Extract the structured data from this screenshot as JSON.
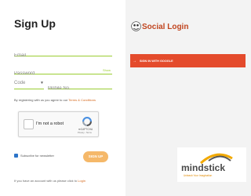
{
  "signup": {
    "title": "Sign Up",
    "email_placeholder": "Email",
    "password_placeholder": "Password",
    "show_label": "Show",
    "code_label": "Code",
    "code_caret": "▼",
    "mobile_placeholder": "Mobile No.",
    "agree_text": "By registering with us you agree to our ",
    "agree_link": "Terms & Conditions",
    "newsletter_label": "Subscribe for newsletter",
    "button_label": "SIGN UP",
    "login_text": "If you have an account with us please click to ",
    "login_link": "Login"
  },
  "captcha": {
    "label": "I'm not a robot",
    "brand": "reCAPTCHA",
    "terms": "Privacy - Terms"
  },
  "social": {
    "title": "Social Login",
    "google_label": "SIGN IN WITH GOOGLE",
    "google_arrow": "→",
    "google_color": "#e44b2c"
  },
  "mindstick": {
    "word": "mindstick",
    "tagline": "Unleash Your Imagination"
  }
}
